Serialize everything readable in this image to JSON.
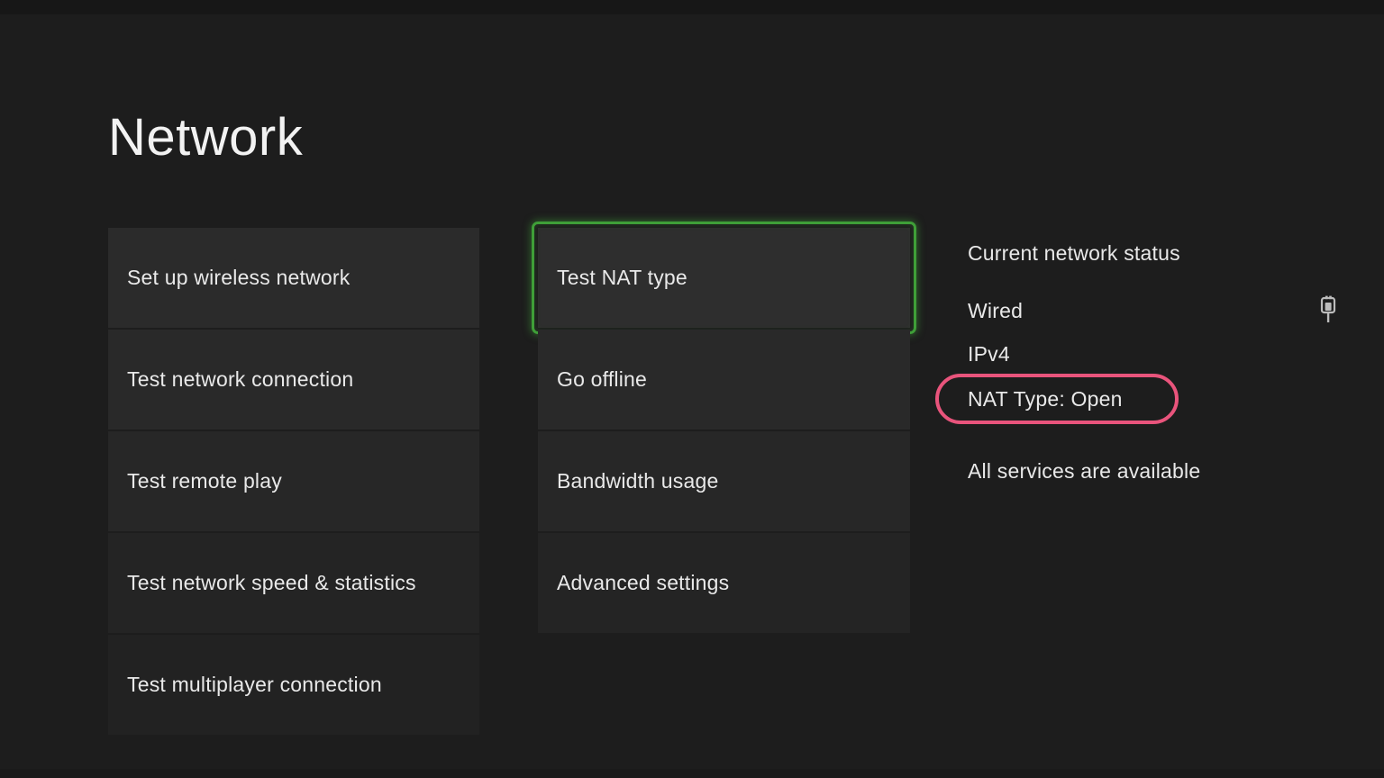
{
  "page": {
    "title": "Network",
    "background_color": "#1d1d1d",
    "tile_color": "#2b2b2b",
    "focus_color": "#3f9f38",
    "highlight_color": "#e9547c",
    "text_color": "#e9e9e9"
  },
  "columns": {
    "left": {
      "items": [
        {
          "label": "Set up wireless network"
        },
        {
          "label": "Test network connection"
        },
        {
          "label": "Test remote play"
        },
        {
          "label": "Test network speed & statistics"
        },
        {
          "label": "Test multiplayer connection"
        }
      ]
    },
    "middle": {
      "items": [
        {
          "label": "Test NAT type",
          "focused": true
        },
        {
          "label": "Go offline",
          "focused": false
        },
        {
          "label": "Bandwidth usage",
          "focused": false
        },
        {
          "label": "Advanced settings",
          "focused": false
        }
      ]
    },
    "right": {
      "heading": "Current network status",
      "connection_type": "Wired",
      "ip_version": "IPv4",
      "nat_type": "NAT Type: Open",
      "services_status": "All services are available",
      "connection_icon": "wired-plug-icon"
    }
  }
}
